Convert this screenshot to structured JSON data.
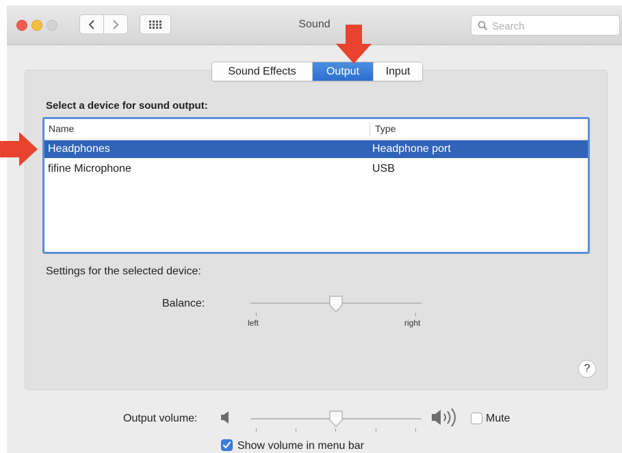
{
  "window": {
    "title": "Sound",
    "search_placeholder": "Search"
  },
  "tabs": [
    {
      "label": "Sound Effects",
      "active": false
    },
    {
      "label": "Output",
      "active": true
    },
    {
      "label": "Input",
      "active": false
    }
  ],
  "output": {
    "section_title": "Select a device for sound output:",
    "columns": {
      "name": "Name",
      "type": "Type"
    },
    "devices": [
      {
        "name": "Headphones",
        "type": "Headphone port",
        "selected": true
      },
      {
        "name": "fifine Microphone",
        "type": "USB",
        "selected": false
      }
    ],
    "settings_label": "Settings for the selected device:",
    "balance": {
      "label": "Balance:",
      "left_label": "left",
      "right_label": "right",
      "value": 0.5
    },
    "help": "?"
  },
  "volume": {
    "label": "Output volume:",
    "value": 0.5,
    "mute_label": "Mute",
    "mute_checked": false,
    "show_in_menu_bar_label": "Show volume in menu bar",
    "show_in_menu_bar_checked": true
  },
  "colors": {
    "selection": "#2f64b8",
    "active_tab": "#2d6fce",
    "annotation_arrow": "#e8432e"
  }
}
